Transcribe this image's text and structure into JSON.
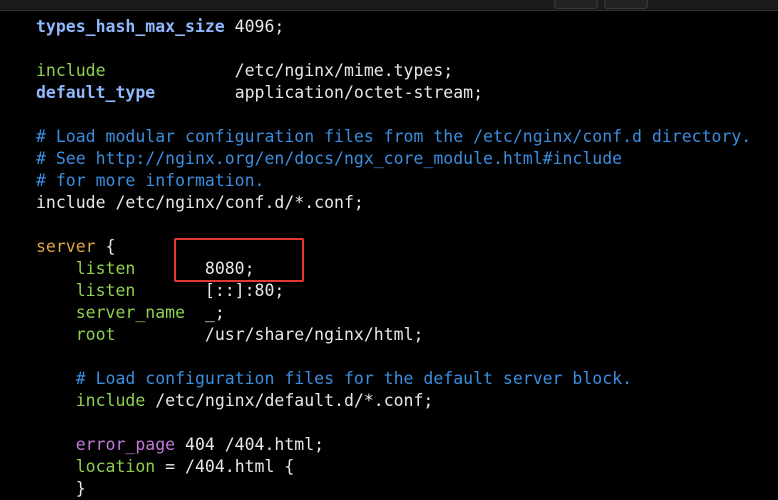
{
  "editor": {
    "lines": [
      {
        "parts": [
          {
            "text": "types_hash_max_size",
            "cls": "kw"
          },
          {
            "text": " 4096;",
            "cls": "val"
          }
        ]
      },
      {
        "parts": [
          {
            "text": "include",
            "cls": "inc"
          },
          {
            "text": "             /etc/nginx/mime.types;",
            "cls": "val"
          }
        ]
      },
      {
        "parts": [
          {
            "text": "default_type",
            "cls": "kw"
          },
          {
            "text": "        application/octet-stream;",
            "cls": "val"
          }
        ]
      },
      {
        "parts": [
          {
            "text": "# Load modular configuration files from the /etc/nginx/conf.d directory.",
            "cls": "com"
          }
        ]
      },
      {
        "parts": [
          {
            "text": "# See http://nginx.org/en/docs/ngx_core_module.html#include",
            "cls": "com"
          }
        ]
      },
      {
        "parts": [
          {
            "text": "# for more information.",
            "cls": "com"
          }
        ]
      },
      {
        "parts": [
          {
            "text": "include",
            "cls": "val"
          },
          {
            "text": " /etc/nginx/conf.d/*.conf;",
            "cls": "val"
          }
        ]
      },
      {
        "parts": [
          {
            "text": "server",
            "cls": "ctx"
          },
          {
            "text": " {",
            "cls": "val"
          }
        ]
      },
      {
        "parts": [
          {
            "text": "    listen",
            "cls": "dir"
          },
          {
            "text": "       8080;",
            "cls": "val"
          }
        ]
      },
      {
        "parts": [
          {
            "text": "    listen",
            "cls": "dir"
          },
          {
            "text": "       [::]:80;",
            "cls": "val"
          }
        ]
      },
      {
        "parts": [
          {
            "text": "    server_name",
            "cls": "dir"
          },
          {
            "text": "  _;",
            "cls": "val"
          }
        ]
      },
      {
        "parts": [
          {
            "text": "    root",
            "cls": "dir"
          },
          {
            "text": "         /usr/share/nginx/html;",
            "cls": "val"
          }
        ]
      },
      {
        "parts": [
          {
            "text": "    # Load configuration files for the default server block.",
            "cls": "com"
          }
        ]
      },
      {
        "parts": [
          {
            "text": "    include",
            "cls": "dir"
          },
          {
            "text": " /etc/nginx/default.d/*.conf;",
            "cls": "val"
          }
        ]
      },
      {
        "parts": [
          {
            "text": "    error_page",
            "cls": "ep"
          },
          {
            "text": " 404 /404.html;",
            "cls": "val"
          }
        ]
      },
      {
        "parts": [
          {
            "text": "    location",
            "cls": "dir"
          },
          {
            "text": " = /404.html {",
            "cls": "val"
          }
        ]
      },
      {
        "parts": [
          {
            "text": "    }",
            "cls": "val"
          }
        ]
      }
    ]
  },
  "colors": {
    "background": "#000000",
    "comment": "#3b8ee0",
    "highlight_box": "#e53935"
  }
}
